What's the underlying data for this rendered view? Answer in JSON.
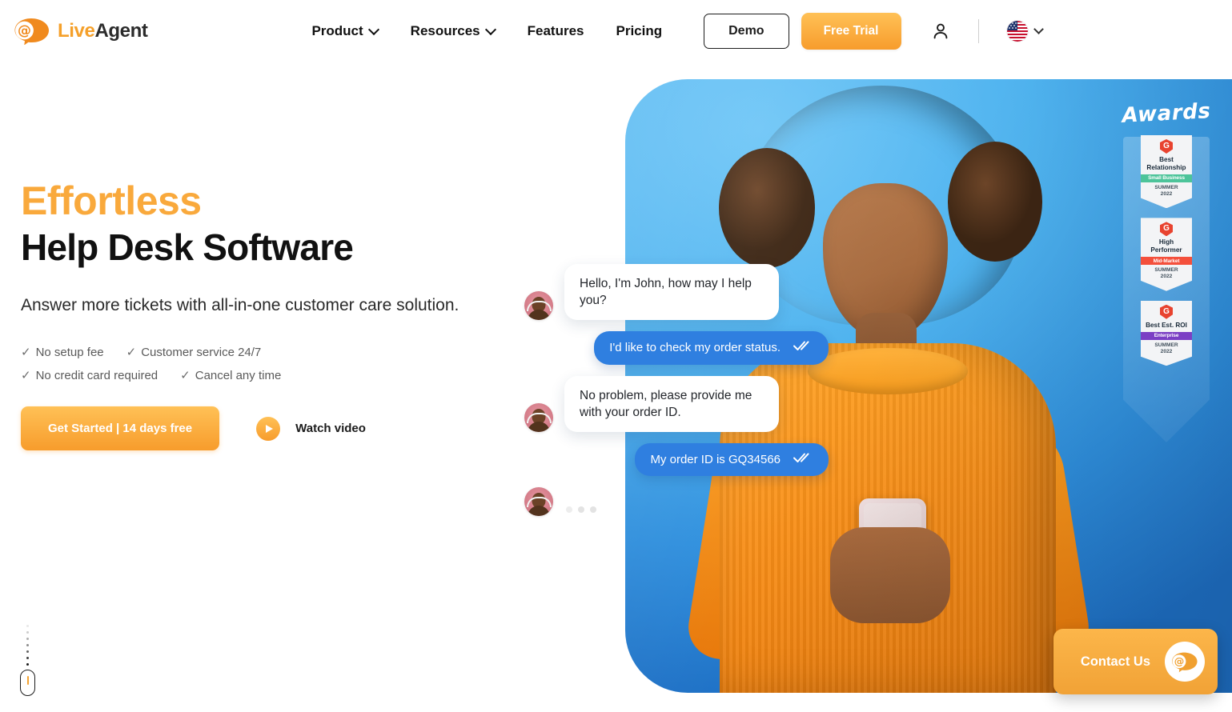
{
  "header": {
    "logo": {
      "icon": "at-speech-bubble-icon",
      "text_primary": "Live",
      "text_secondary": "Agent"
    },
    "nav": [
      {
        "label": "Product",
        "has_dropdown": true
      },
      {
        "label": "Resources",
        "has_dropdown": true
      },
      {
        "label": "Features",
        "has_dropdown": false
      },
      {
        "label": "Pricing",
        "has_dropdown": false
      }
    ],
    "demo_label": "Demo",
    "trial_label": "Free Trial",
    "account_icon": "user-icon",
    "language": {
      "flag": "us-flag-icon",
      "chevron": "chevron-down-icon"
    }
  },
  "hero": {
    "eyebrow": "Effortless",
    "title": "Help Desk Software",
    "subtitle": "Answer more tickets with all-in-one customer care solution.",
    "features": [
      "No setup fee",
      "Customer service 24/7",
      "No credit card required",
      "Cancel any time"
    ],
    "tick": "✓",
    "cta_primary": "Get Started | 14 days free",
    "cta_video": "Watch video",
    "play_icon": "play-icon",
    "scroll_icon": "scroll-down-mouse-icon"
  },
  "chat": {
    "messages": [
      {
        "from": "agent",
        "text": "Hello, I'm John, how may I help you?"
      },
      {
        "from": "customer",
        "text": "I'd like to check my order status."
      },
      {
        "from": "agent",
        "text": "No problem, please provide me with your order ID."
      },
      {
        "from": "customer",
        "text": "My order ID is GQ34566"
      },
      {
        "from": "agent",
        "text": "",
        "typing": true
      }
    ],
    "read_icon": "double-check-icon",
    "avatar_name": "agent-avatar"
  },
  "awards": {
    "title": "Awards",
    "badges": [
      {
        "brand": "G",
        "name": "Best Relationship",
        "segment": "Small Business",
        "segment_color": "#4dc49a",
        "season": "SUMMER",
        "year": "2022"
      },
      {
        "brand": "G",
        "name": "High Performer",
        "segment": "Mid-Market",
        "segment_color": "#f4503c",
        "season": "SUMMER",
        "year": "2022"
      },
      {
        "brand": "G",
        "name": "Best Est. ROI",
        "segment": "Enterprise",
        "segment_color": "#7b3fc4",
        "season": "SUMMER",
        "year": "2022"
      }
    ]
  },
  "contact_widget": {
    "label": "Contact Us",
    "icon": "at-speech-bubble-icon"
  },
  "colors": {
    "brand_orange": "#f79c2c",
    "brand_orange_light": "#ffc156",
    "heading_accent": "#f9a93c",
    "chat_blue": "#2f7fe0",
    "hero_blue": "#4fb3ef",
    "text_dark": "#1b1b1b",
    "text_muted": "#5a5a5a"
  }
}
